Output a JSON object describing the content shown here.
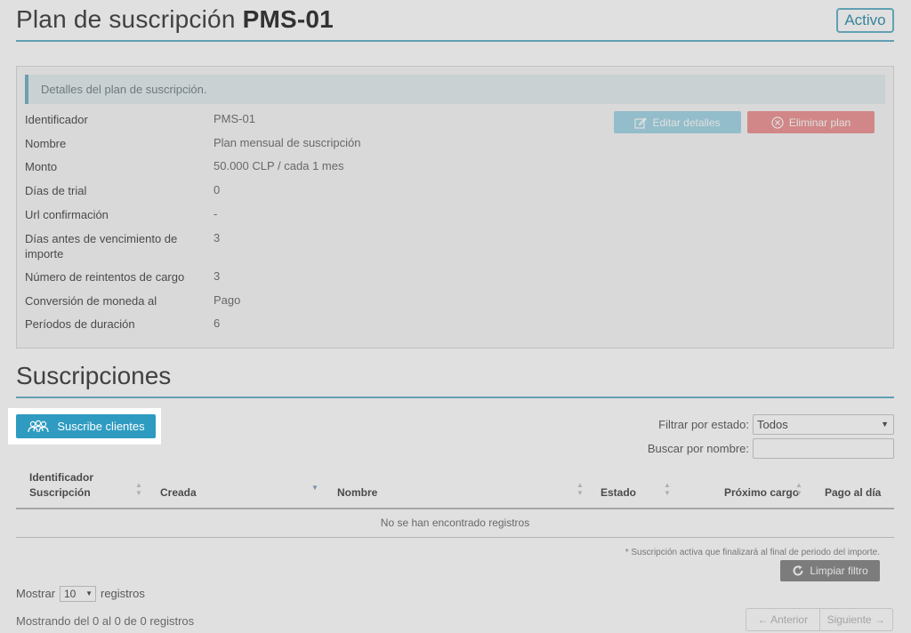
{
  "header": {
    "title_prefix": "Plan de suscripción",
    "title_code": "PMS-01",
    "status": "Activo"
  },
  "details": {
    "info_text": "Detalles del plan de suscripción.",
    "rows": [
      {
        "label": "Identificador",
        "value": "PMS-01"
      },
      {
        "label": "Nombre",
        "value": "Plan mensual de suscripción"
      },
      {
        "label": "Monto",
        "value": "50.000 CLP / cada 1 mes"
      },
      {
        "label": "Días de trial",
        "value": "0"
      },
      {
        "label": "Url confirmación",
        "value": "-"
      },
      {
        "label": "Días antes de vencimiento de importe",
        "value": "3"
      },
      {
        "label": "Número de reintentos de cargo",
        "value": "3"
      },
      {
        "label": "Conversión de moneda al",
        "value": "Pago"
      },
      {
        "label": "Períodos de duración",
        "value": "6"
      }
    ],
    "edit_label": "Editar detalles",
    "delete_label": "Eliminar plan"
  },
  "subscriptions": {
    "title": "Suscripciones",
    "subscribe_label": "Suscribe clientes",
    "filter_label": "Filtrar por estado:",
    "filter_value": "Todos",
    "search_label": "Buscar por nombre:",
    "columns": [
      "Identificador Suscripción",
      "Creada",
      "Nombre",
      "Estado",
      "Próximo cargo",
      "Pago al día"
    ],
    "empty_text": "No se han encontrado registros",
    "footnote": "* Suscripción activa que finalizará al final de periodo del importe.",
    "clear_label": "Limpiar filtro",
    "show_label": "Mostrar",
    "page_size": "10",
    "show_suffix": "registros",
    "showing_text": "Mostrando del 0 al 0 de 0 registros",
    "prev_label": "← Anterior",
    "next_label": "Siguiente →"
  },
  "colors": {
    "accent": "#2f9bc1",
    "rule": "#6fb7cc",
    "edit_button": "#a8d8e6",
    "delete_button": "#ee9a9a",
    "clear_button": "#8e8e8e"
  }
}
